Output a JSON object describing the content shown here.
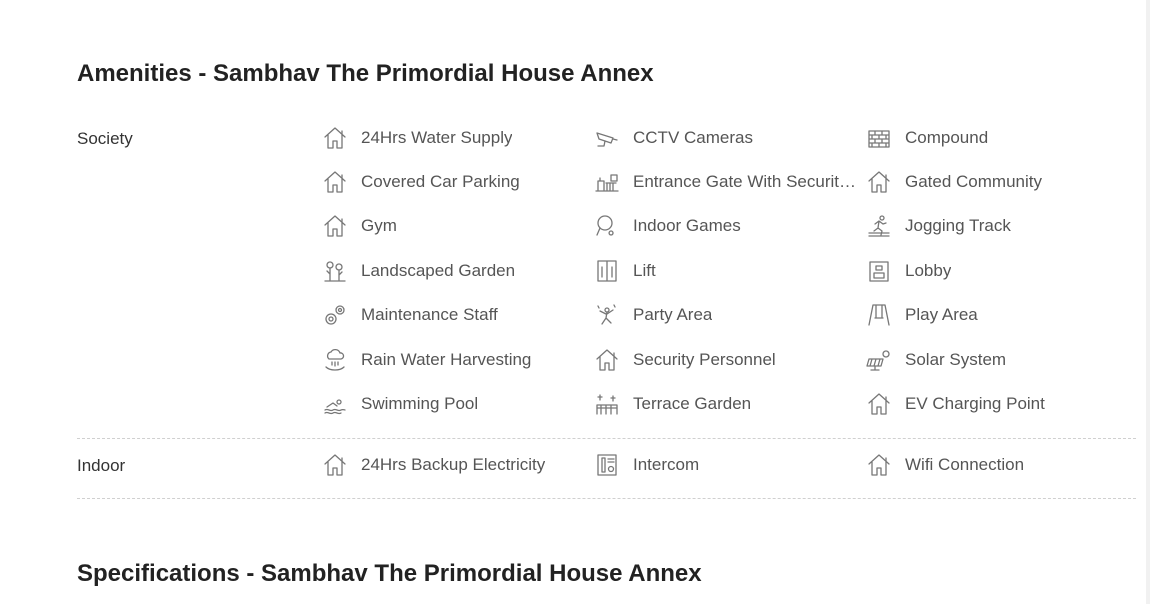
{
  "amenities_title": "Amenities - Sambhav The Primordial House Annex",
  "specifications_title": "Specifications - Sambhav The Primordial House Annex",
  "groups": [
    {
      "label": "Society",
      "items": [
        {
          "label": "24Hrs Water Supply",
          "icon": "house-icon"
        },
        {
          "label": "CCTV Cameras",
          "icon": "cctv-camera-icon"
        },
        {
          "label": "Compound",
          "icon": "brick-wall-icon"
        },
        {
          "label": "Covered Car Parking",
          "icon": "house-icon"
        },
        {
          "label": "Entrance Gate With Security Cabin",
          "icon": "security-gate-icon"
        },
        {
          "label": "Gated Community",
          "icon": "house-icon"
        },
        {
          "label": "Gym",
          "icon": "house-icon"
        },
        {
          "label": "Indoor Games",
          "icon": "table-tennis-icon"
        },
        {
          "label": "Jogging Track",
          "icon": "jogger-icon"
        },
        {
          "label": "Landscaped Garden",
          "icon": "flowers-icon"
        },
        {
          "label": "Lift",
          "icon": "elevator-icon"
        },
        {
          "label": "Lobby",
          "icon": "lobby-icon"
        },
        {
          "label": "Maintenance Staff",
          "icon": "gears-icon"
        },
        {
          "label": "Party Area",
          "icon": "party-icon"
        },
        {
          "label": "Play Area",
          "icon": "swing-icon"
        },
        {
          "label": "Rain Water Harvesting",
          "icon": "rain-cloud-icon"
        },
        {
          "label": "Security Personnel",
          "icon": "house-icon"
        },
        {
          "label": "Solar System",
          "icon": "solar-panel-icon"
        },
        {
          "label": "Swimming Pool",
          "icon": "swimmer-icon"
        },
        {
          "label": "Terrace Garden",
          "icon": "terrace-icon"
        },
        {
          "label": "EV Charging Point",
          "icon": "house-icon"
        }
      ]
    },
    {
      "label": "Indoor",
      "items": [
        {
          "label": "24Hrs Backup Electricity",
          "icon": "house-icon"
        },
        {
          "label": "Intercom",
          "icon": "intercom-icon"
        },
        {
          "label": "Wifi Connection",
          "icon": "house-icon"
        }
      ]
    }
  ]
}
